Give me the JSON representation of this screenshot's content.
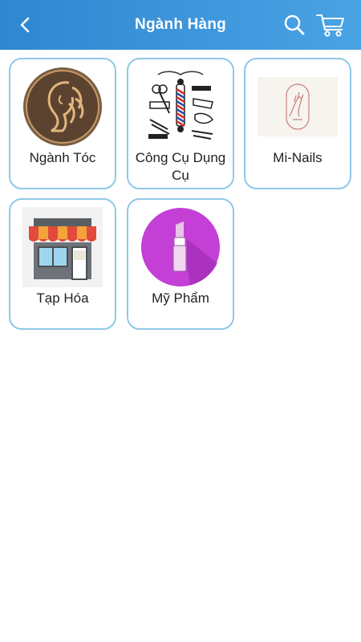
{
  "header": {
    "title": "Ngành Hàng",
    "back_icon": "chevron-left-icon",
    "search_icon": "search-icon",
    "cart_icon": "cart-icon",
    "background": "#3a93da"
  },
  "categories": [
    {
      "label": "Ngành Tóc",
      "icon": "hair-salon-logo"
    },
    {
      "label": "Công Cụ Dụng Cụ",
      "icon": "barbershop-tools"
    },
    {
      "label": "Mi-Nails",
      "icon": "nails-logo"
    },
    {
      "label": "Tạp Hóa",
      "icon": "grocery-store-icon"
    },
    {
      "label": "Mỹ Phẩm",
      "icon": "lipstick-icon"
    }
  ]
}
